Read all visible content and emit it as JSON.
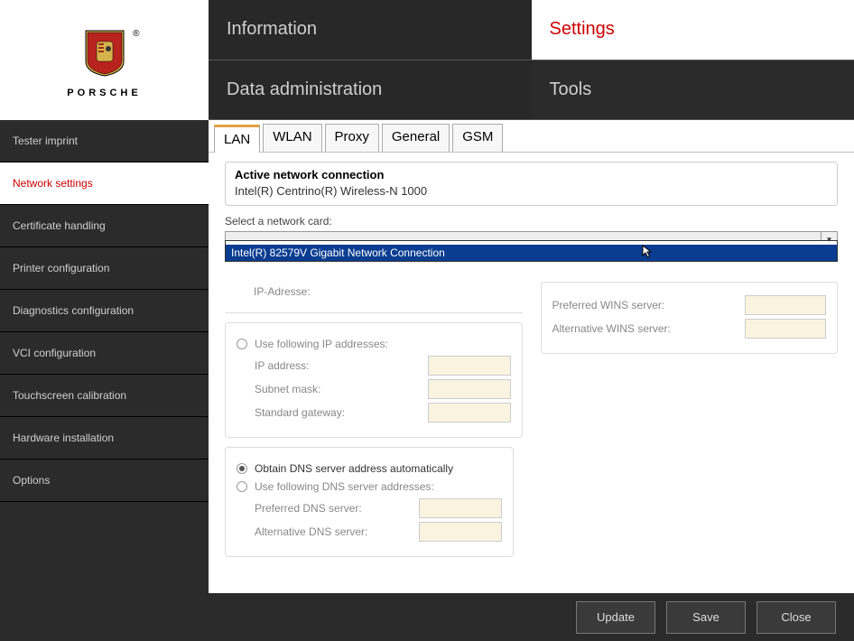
{
  "brand": {
    "word": "PORSCHE",
    "reg": "®"
  },
  "header": {
    "information": "Information",
    "settings": "Settings",
    "data_admin": "Data administration",
    "tools": "Tools"
  },
  "sidebar": {
    "items": [
      "Tester imprint",
      "Network settings",
      "Certificate handling",
      "Printer configuration",
      "Diagnostics configuration",
      "VCI configuration",
      "Touchscreen calibration",
      "Hardware installation",
      "Options"
    ],
    "active_index": 1
  },
  "tabs": {
    "items": [
      "LAN",
      "WLAN",
      "Proxy",
      "General",
      "GSM"
    ],
    "active_index": 0
  },
  "active_connection": {
    "label": "Active network connection",
    "value": "Intel(R) Centrino(R) Wireless-N 1000"
  },
  "network_card": {
    "label": "Select a network card:",
    "options": [
      "",
      "Intel(R) 82579V Gigabit Network Connection"
    ],
    "selected_index": 1
  },
  "ip_section": {
    "ip_adresse_label": "IP-Adresse:",
    "use_following_ip": "Use following IP addresses:",
    "ip_address_label": "IP address:",
    "subnet_label": "Subnet mask:",
    "gateway_label": "Standard gateway:"
  },
  "wins": {
    "preferred_label": "Preferred WINS server:",
    "alternative_label": "Alternative WINS server:"
  },
  "dns": {
    "obtain_auto": "Obtain DNS server address automatically",
    "use_following": "Use following DNS server addresses:",
    "preferred_label": "Preferred DNS server:",
    "alternative_label": "Alternative DNS server:",
    "mode": "auto"
  },
  "footer": {
    "update": "Update",
    "save": "Save",
    "close": "Close"
  }
}
